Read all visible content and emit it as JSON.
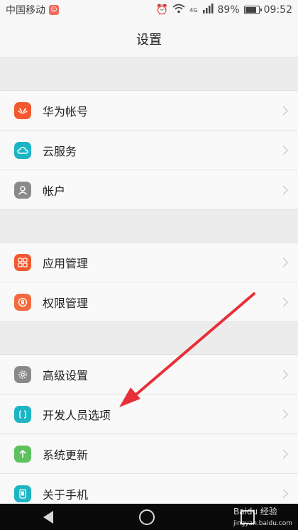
{
  "status_bar": {
    "carrier": "中国移动",
    "network_type": "4G",
    "battery_percent": "89%",
    "battery_level": 0.89,
    "time": "09:52",
    "icons": [
      "app-notification-icon",
      "alarm-icon",
      "wifi-icon",
      "signal-icon",
      "battery-icon"
    ]
  },
  "header": {
    "title": "设置"
  },
  "settings": {
    "groups": [
      {
        "items": [
          {
            "label": "华为帐号",
            "icon": "huawei-logo-icon",
            "color": "#f3582e"
          },
          {
            "label": "云服务",
            "icon": "cloud-icon",
            "color": "#1cb5c4"
          },
          {
            "label": "帐户",
            "icon": "user-icon",
            "color": "#8a8a8a"
          }
        ]
      },
      {
        "items": [
          {
            "label": "应用管理",
            "icon": "apps-grid-icon",
            "color": "#f3582e"
          },
          {
            "label": "权限管理",
            "icon": "permission-lock-icon",
            "color": "#f26a3d"
          }
        ]
      },
      {
        "items": [
          {
            "label": "高级设置",
            "icon": "gear-icon",
            "color": "#8a8a8a"
          },
          {
            "label": "开发人员选项",
            "icon": "code-braces-icon",
            "color": "#1cb5c4"
          },
          {
            "label": "系统更新",
            "icon": "update-arrow-icon",
            "color": "#5cc15e"
          },
          {
            "label": "关于手机",
            "icon": "phone-icon",
            "color": "#1cb5c4"
          }
        ]
      }
    ]
  },
  "watermark": {
    "text": "jingyan.baidu.com",
    "logo_text": "Baidu 经验"
  },
  "annotation_color": "#e8303a"
}
